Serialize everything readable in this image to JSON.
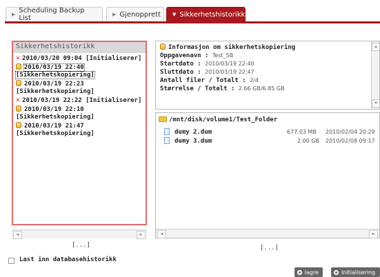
{
  "tabs": [
    {
      "label": "Scheduling Backup List",
      "active": false
    },
    {
      "label": "Gjenopprett",
      "active": false
    },
    {
      "label": "Sikkerhetshistorikk",
      "active": true
    }
  ],
  "history_panel": {
    "title": "Sikkerhetshistorikk",
    "entries": [
      {
        "icon": "x-icon",
        "line1": "2010/03/20 09:04 [Initialiserer]",
        "line2": ""
      },
      {
        "icon": "backup-icon",
        "line1": "2010/03/19 22:40",
        "line2": "[Sikkerhetskopiering]",
        "selected": true
      },
      {
        "icon": "backup-icon",
        "line1": "2010/03/19 22:23",
        "line2": "[Sikkerhetskopiering]"
      },
      {
        "icon": "x-icon",
        "line1": "2010/03/19 22:22 [Initialiserer]",
        "line2": ""
      },
      {
        "icon": "backup-icon",
        "line1": "2010/03/19 22:10",
        "line2": "[Sikkerhetskopiering]"
      },
      {
        "icon": "backup-icon",
        "line1": "2010/03/19 21:47",
        "line2": "[Sikkerhetskopiering]"
      }
    ],
    "more": "[...]"
  },
  "info_panel": {
    "title": "Informasjon om sikkerhetskopiering",
    "rows": [
      {
        "key": "Oppgavenavn :",
        "value": "Test_SB"
      },
      {
        "key": "Startdato :",
        "value": "2010/03/19 22:40"
      },
      {
        "key": "Sluttdato :",
        "value": "2010/03/19 22:47"
      },
      {
        "key": "Antall filer / Totalt :",
        "value": "2/4"
      },
      {
        "key": "Størrelse / Totalt :",
        "value": "2.66 GB/6.85 GB"
      }
    ]
  },
  "files_panel": {
    "path": "/mnt/disk/volume1/Test_Folder",
    "files": [
      {
        "name": "dumy 2.dum",
        "size": "677.03 MB",
        "date": "2010/02/04 20:29"
      },
      {
        "name": "dumy 3.dum",
        "size": "2.00 GB",
        "date": "2010/02/08 09:17"
      }
    ],
    "more": "[...]"
  },
  "checkbox": {
    "label": "Last inn databasehistorikk",
    "checked": false
  },
  "buttons": {
    "save": "lagre",
    "init": "Initialisering"
  },
  "colors": {
    "accent": "#a8181c",
    "error": "#d01818",
    "selection_border": "#e06a6a"
  }
}
